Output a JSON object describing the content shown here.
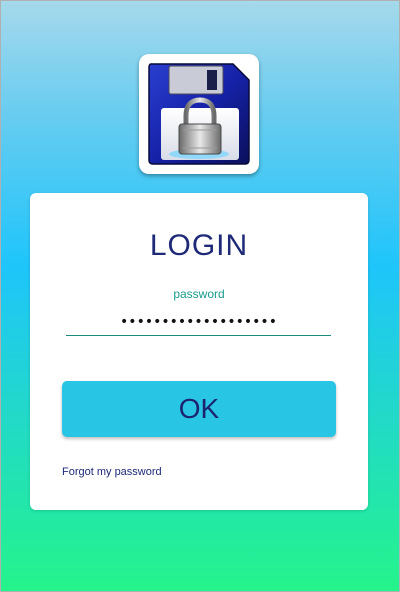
{
  "app_icon": {
    "icon": "floppy-disk-lock-icon"
  },
  "login_card": {
    "title": "LOGIN",
    "password_label": "password",
    "password_value": "•••••••••••••••••••",
    "ok_label": "OK",
    "forgot_label": "Forgot my password"
  },
  "colors": {
    "title": "#1e2a78",
    "label": "#1a9a8c",
    "button": "#29c5e4",
    "background_top": "#a6d9ec",
    "background_bottom": "#24f48b"
  }
}
